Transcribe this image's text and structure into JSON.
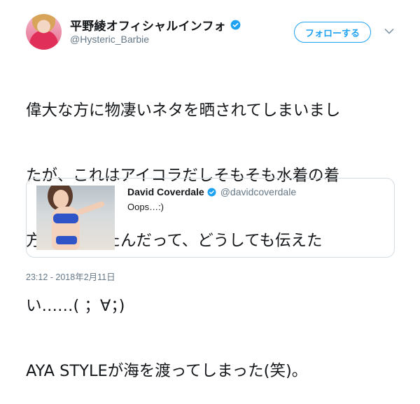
{
  "author": {
    "display_name": "平野綾オフィシャルインフォ",
    "handle": "@Hysteric_Barbie",
    "verified": true
  },
  "follow_button": {
    "label": "フォローする"
  },
  "tweet": {
    "lines": [
      "偉大な方に物凄いネタを晒されてしまいまし",
      "たが、これはアイコラだしそもそも水着の着",
      "方を間違えたんだって、どうしても伝えた",
      "い……(  ；∀；)",
      "AYA STYLEが海を渡ってしまった(笑)。"
    ]
  },
  "quoted_tweet": {
    "display_name": "David Coverdale",
    "handle": "@davidcoverdale",
    "verified": true,
    "text": "Oops…:)"
  },
  "timestamp": "23:12 - 2018年2月11日",
  "colors": {
    "accent": "#1da1f2",
    "text": "#14171a",
    "muted": "#657786",
    "border": "#d5dde3"
  },
  "icons": [
    "verified-badge-icon",
    "chevron-down-icon"
  ]
}
